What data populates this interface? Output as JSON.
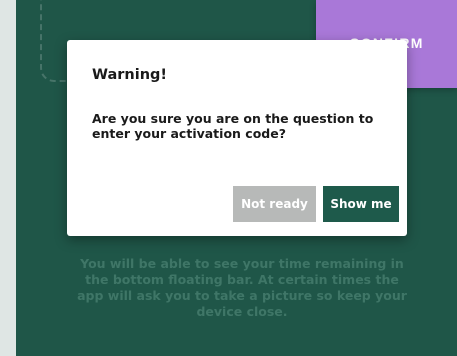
{
  "background": {
    "hint_text": "You will be able to see your time remaining in the bottom floating bar. At certain times the app will ask you to take a picture so keep your device close."
  },
  "confirm_tab": {
    "label": "CONFIRM"
  },
  "dialog": {
    "title": "Warning!",
    "message": "Are you sure you are on the question to enter your activation code?",
    "buttons": {
      "not_ready": "Not ready",
      "show_me": "Show me"
    }
  },
  "colors": {
    "screen_background": "#1f5648",
    "accent_purple": "#a978d8",
    "primary_button": "#1e5a4b",
    "secondary_button": "#b7b9b8"
  }
}
